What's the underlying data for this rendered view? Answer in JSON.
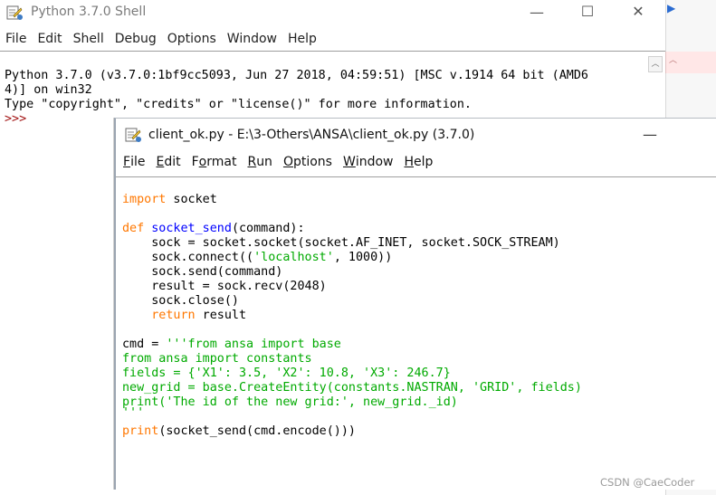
{
  "shell": {
    "title": "Python 3.7.0 Shell",
    "controls": {
      "minimize": "—",
      "maximize": "☐",
      "close": "✕"
    },
    "menu": [
      "File",
      "Edit",
      "Shell",
      "Debug",
      "Options",
      "Window",
      "Help"
    ],
    "output": {
      "line1": "Python 3.7.0 (v3.7.0:1bf9cc5093, Jun 27 2018, 04:59:51) [MSC v.1914 64 bit (AMD6",
      "line2": "4)] on win32",
      "line3": "Type \"copyright\", \"credits\" or \"license()\" for more information.",
      "prompt": ">>>"
    }
  },
  "editor": {
    "title": "client_ok.py - E:\\3-Others\\ANSA\\client_ok.py (3.7.0)",
    "minimize": "—",
    "menu": [
      {
        "u": "F",
        "rest": "ile"
      },
      {
        "u": "E",
        "rest": "dit"
      },
      {
        "pre": "F",
        "u": "o",
        "rest": "rmat"
      },
      {
        "u": "R",
        "rest": "un"
      },
      {
        "u": "O",
        "rest": "ptions"
      },
      {
        "u": "W",
        "rest": "indow"
      },
      {
        "u": "H",
        "rest": "elp"
      }
    ],
    "code": {
      "l1_kw": "import",
      "l1_rest": " socket",
      "l3_kw": "def",
      "l3_fn": "socket_send",
      "l3_rest": "(command):",
      "l4": "    sock = socket.socket(socket.AF_INET, socket.SOCK_STREAM)",
      "l5a": "    sock.connect((",
      "l5s": "'localhost'",
      "l5b": ", 1000))",
      "l6": "    sock.send(command)",
      "l7": "    result = sock.recv(2048)",
      "l8": "    sock.close()",
      "l9_kw": "    return",
      "l9_rest": " result",
      "l11a": "cmd = ",
      "l11s": "'''from ansa import base",
      "l12": "from ansa import constants",
      "l13": "fields = {'X1': 3.5, 'X2': 10.8, 'X3': 246.7}",
      "l14": "new_grid = base.CreateEntity(constants.NASTRAN, 'GRID', fields)",
      "l15": "print('The id of the new grid:', new_grid._id)",
      "l16": "'''",
      "l17_kw": "print",
      "l17_rest": "(socket_send(cmd.encode()))"
    }
  },
  "watermark": "CSDN @CaeCoder",
  "colors": {
    "keyword": "#ff7700",
    "function": "#0000ff",
    "string": "#00aa00"
  }
}
